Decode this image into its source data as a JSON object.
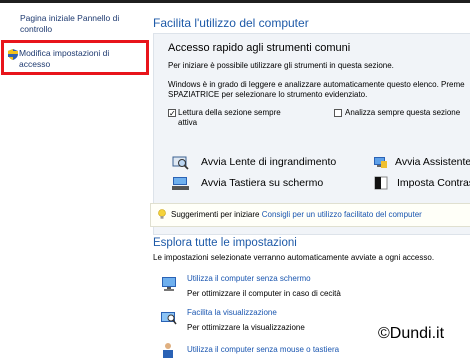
{
  "sidebar": {
    "items": [
      {
        "label_line1": "Pagina iniziale Pannello di",
        "label_line2": "controllo"
      },
      {
        "label_line1": "Modifica impostazioni di",
        "label_line2": "accesso"
      }
    ]
  },
  "main": {
    "title": "Facilita l'utilizzo del computer",
    "panel": {
      "heading": "Accesso rapido agli strumenti comuni",
      "intro": "Per iniziare è possibile utilizzare gli strumenti in questa sezione.",
      "detail_line1": "Windows è in grado di leggere e analizzare automaticamente questo elenco. Preme",
      "detail_line2": "SPAZIATRICE per selezionare lo strumento evidenziato.",
      "check1_line1": "Lettura della sezione sempre",
      "check1_line2": "attiva",
      "check1_checked": "✓",
      "check2": "Analizza sempre questa sezione",
      "tools": [
        {
          "label": "Avvia Lente di ingrandimento",
          "icon": "magnifier-icon"
        },
        {
          "label": "Avvia Assistente v",
          "icon": "narrator-icon"
        },
        {
          "label": "Avvia Tastiera su schermo",
          "icon": "keyboard-icon"
        },
        {
          "label": "Imposta Contras",
          "icon": "contrast-icon"
        }
      ]
    },
    "tips": {
      "label": "Suggerimenti per iniziare",
      "link": "Consigli per un utilizzo facilitato del computer"
    },
    "explore": {
      "heading": "Esplora tutte le impostazioni",
      "description": "Le impostazioni selezionate verranno automaticamente avviate a ogni accesso.",
      "items": [
        {
          "title": "Utilizza il computer senza schermo",
          "desc": "Per ottimizzare il computer in caso di cecità",
          "icon": "monitor-icon"
        },
        {
          "title": "Facilita la visualizzazione",
          "desc": "Per ottimizzare la visualizzazione",
          "icon": "display-icon"
        },
        {
          "title": "Utilizza il computer senza mouse o tastiera",
          "desc": "",
          "icon": "person-icon"
        }
      ]
    }
  },
  "watermark": "©Dundi.it"
}
